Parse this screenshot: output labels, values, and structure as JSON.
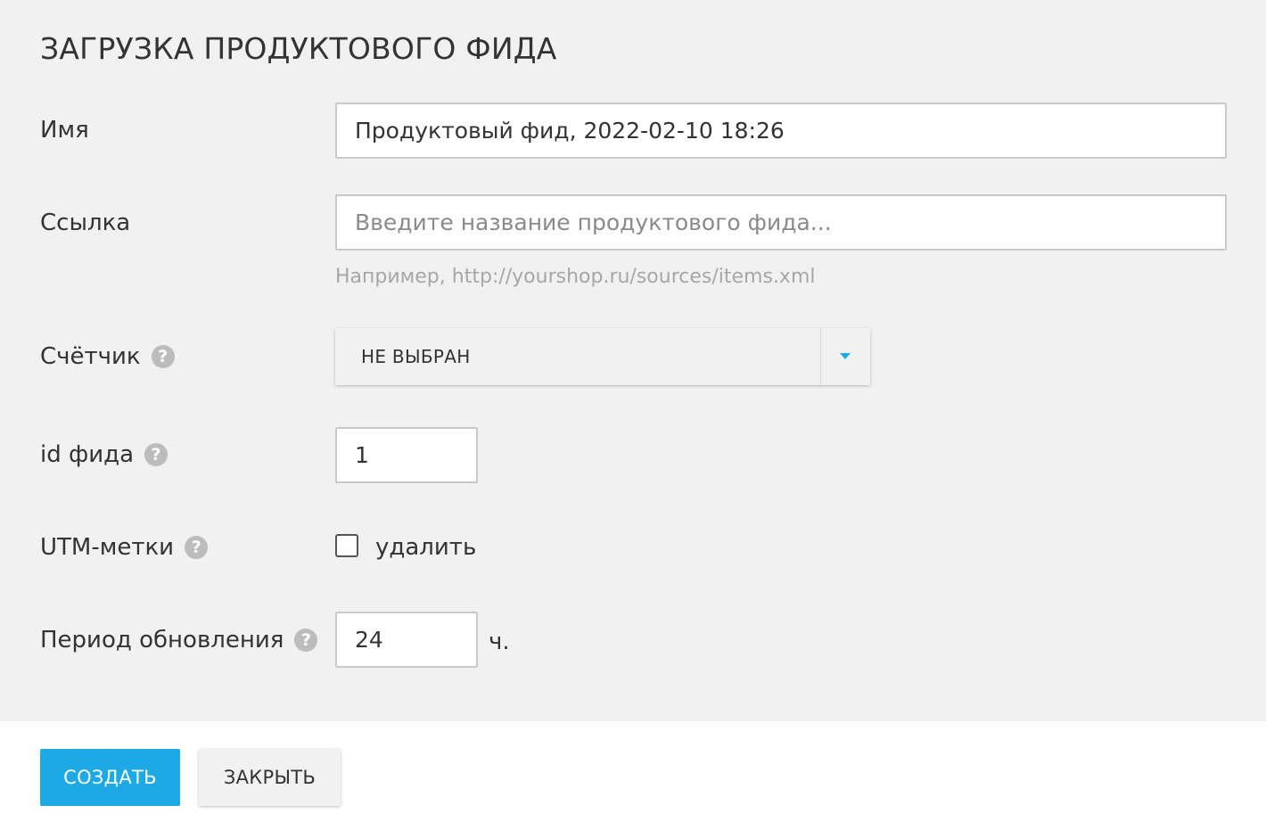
{
  "dialog": {
    "title": "ЗАГРУЗКА ПРОДУКТОВОГО ФИДА"
  },
  "form": {
    "name": {
      "label": "Имя",
      "value": "Продуктовый фид, 2022-02-10 18:26"
    },
    "link": {
      "label": "Ссылка",
      "placeholder": "Введите название продуктового фида...",
      "value": "",
      "hint": "Например, http://yourshop.ru/sources/items.xml"
    },
    "counter": {
      "label": "Счётчик",
      "help": "?",
      "selected": "НЕ ВЫБРАН"
    },
    "feed_id": {
      "label": "id фида",
      "help": "?",
      "value": "1"
    },
    "utm": {
      "label": "UTM-метки",
      "help": "?",
      "checkbox_label": "удалить",
      "checked": false
    },
    "update_period": {
      "label": "Период обновления",
      "help": "?",
      "value": "24",
      "unit": "ч."
    }
  },
  "footer": {
    "create_label": "СОЗДАТЬ",
    "close_label": "ЗАКРЫТЬ"
  },
  "colors": {
    "accent": "#1ca9e6",
    "panel_bg": "#f1f1f1",
    "text": "#333333",
    "hint": "#a7a7a7",
    "help_icon": "#bcbcbc"
  }
}
